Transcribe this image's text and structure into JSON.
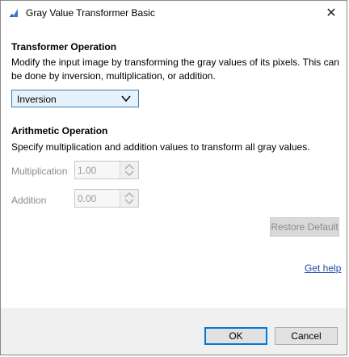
{
  "window": {
    "title": "Gray Value Transformer Basic",
    "close_glyph": "✕"
  },
  "transformer": {
    "heading": "Transformer Operation",
    "description": "Modify the input image by transforming the gray values of its pixels. This can be done by inversion, multiplication, or addition.",
    "operation_selected": "Inversion"
  },
  "arithmetic": {
    "heading": "Arithmetic Operation",
    "description": "Specify multiplication and addition values to transform all gray values.",
    "multiplication_label": "Multiplication",
    "multiplication_value": "1.00",
    "addition_label": "Addition",
    "addition_value": "0.00"
  },
  "actions": {
    "restore_default": "Restore Default",
    "get_help": "Get help",
    "ok": "OK",
    "cancel": "Cancel"
  },
  "colors": {
    "accent": "#0078d7",
    "dropdown_bg": "#e5f1fb",
    "link": "#1a4ea8"
  }
}
